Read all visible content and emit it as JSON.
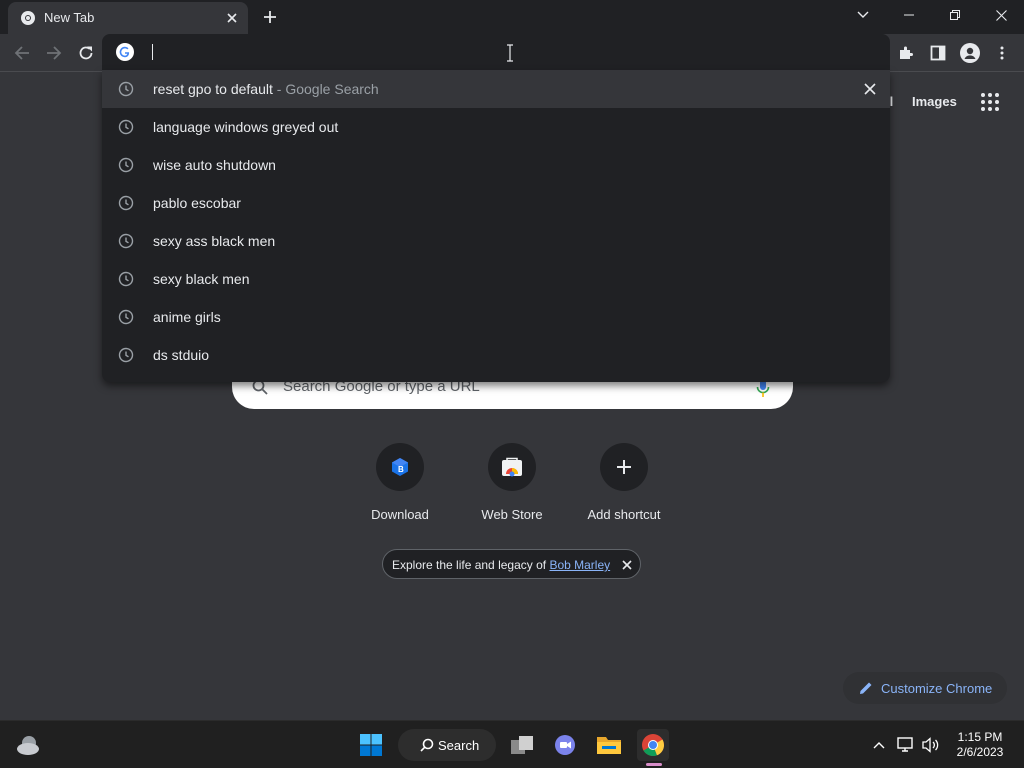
{
  "browser": {
    "tab": {
      "title": "New Tab"
    },
    "omnibox": {
      "value": "",
      "placeholder": ""
    }
  },
  "suggestions": [
    {
      "text": "reset gpo to default",
      "desc": " - Google Search",
      "icon": "history-clock-icon",
      "highlighted": true
    },
    {
      "text": "language windows greyed out",
      "desc": "",
      "icon": "history-clock-icon"
    },
    {
      "text": "wise auto shutdown",
      "desc": "",
      "icon": "history-clock-icon"
    },
    {
      "text": "pablo escobar",
      "desc": "",
      "icon": "history-clock-icon"
    },
    {
      "text": "sexy ass black men",
      "desc": "",
      "icon": "history-clock-icon"
    },
    {
      "text": "sexy black men",
      "desc": "",
      "icon": "history-clock-icon"
    },
    {
      "text": "anime girls",
      "desc": "",
      "icon": "history-clock-icon"
    },
    {
      "text": "ds stduio",
      "desc": "",
      "icon": "history-clock-icon"
    }
  ],
  "ntp": {
    "links": {
      "gmail_partial": "il",
      "images": "Images"
    },
    "search": {
      "placeholder": "Search Google or type a URL"
    },
    "shortcuts": [
      {
        "label": "Download"
      },
      {
        "label": "Web Store"
      },
      {
        "label": "Add shortcut"
      }
    ],
    "doodle_chip": {
      "prefix": "Explore the life and legacy of ",
      "link": "Bob Marley"
    },
    "customize": {
      "label": "Customize Chrome"
    }
  },
  "taskbar": {
    "search_label": "Search",
    "clock": {
      "time": "1:15 PM",
      "date": "2/6/2023"
    }
  },
  "colors": {
    "frame": "#202124",
    "toolbar": "#35363a",
    "accent": "#8ab4f8",
    "taskbar": "#202020"
  }
}
